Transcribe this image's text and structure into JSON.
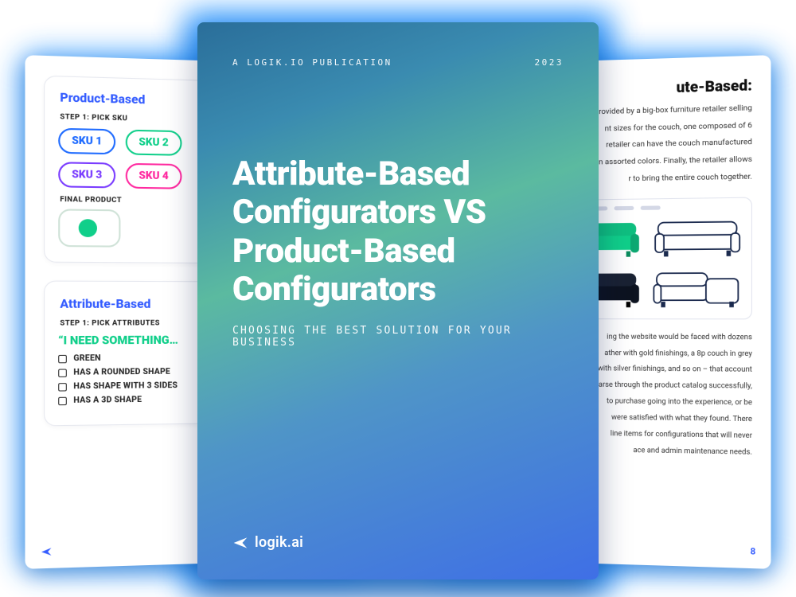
{
  "cover": {
    "publisher": "A LOGIK.IO PUBLICATION",
    "year": "2023",
    "title_line1": "Attribute-Based",
    "title_line2": "Configurators VS",
    "title_line3": "Product-Based",
    "title_line4": "Configurators",
    "subtitle": "CHOOSING THE BEST SOLUTION FOR YOUR BUSINESS",
    "brand": "logik.ai"
  },
  "left_page": {
    "product_card": {
      "title": "Product-Based",
      "step_label": "STEP 1: PICK SKU",
      "skus": [
        "SKU 1",
        "SKU 2",
        "SKU 3",
        "SKU 4"
      ],
      "final_label": "FINAL PRODUCT"
    },
    "attribute_card": {
      "title": "Attribute-Based",
      "step_label": "STEP 1: PICK ATTRIBUTES",
      "prompt": "“I NEED SOMETHING…",
      "options": [
        "GREEN",
        "HAS A ROUNDED SHAPE",
        "HAS SHAPE WITH 3 SIDES",
        "HAS A 3D SHAPE"
      ]
    }
  },
  "right_page": {
    "title_fragment": "ute-Based:",
    "intro_lines": [
      "e provided by a big-box furniture retailer selling",
      "nt sizes for the couch, one composed of 6",
      "retailer can have the couch manufactured",
      "n in assorted colors. Finally, the retailer allows",
      "r to bring the entire couch together."
    ],
    "body_lines": [
      "ing the website would be faced with dozens",
      "ather with gold finishings, a 8p couch in grey",
      "with silver finishings, and so on – that account",
      "arse through the product catalog successfully,",
      "to purchase going into the experience, or be",
      "were satisfied with what they found. There",
      "line items for configurations that will never",
      "ace and admin maintenance needs."
    ],
    "page_number": "8"
  }
}
